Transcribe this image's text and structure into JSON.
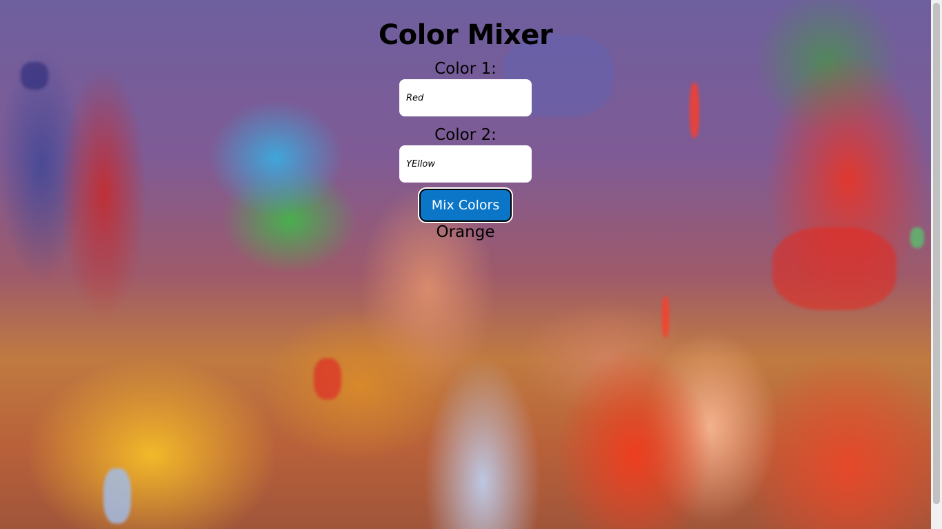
{
  "page": {
    "title": "Color Mixer"
  },
  "form": {
    "color1": {
      "label": "Color 1:",
      "value": "Red"
    },
    "color2": {
      "label": "Color 2:",
      "value": "YEllow"
    },
    "mix_button_label": "Mix Colors",
    "result": "Orange"
  },
  "colors": {
    "button_bg": "#0b76c8",
    "button_text": "#ffffff",
    "input_bg": "#ffffff",
    "text": "#000000"
  }
}
